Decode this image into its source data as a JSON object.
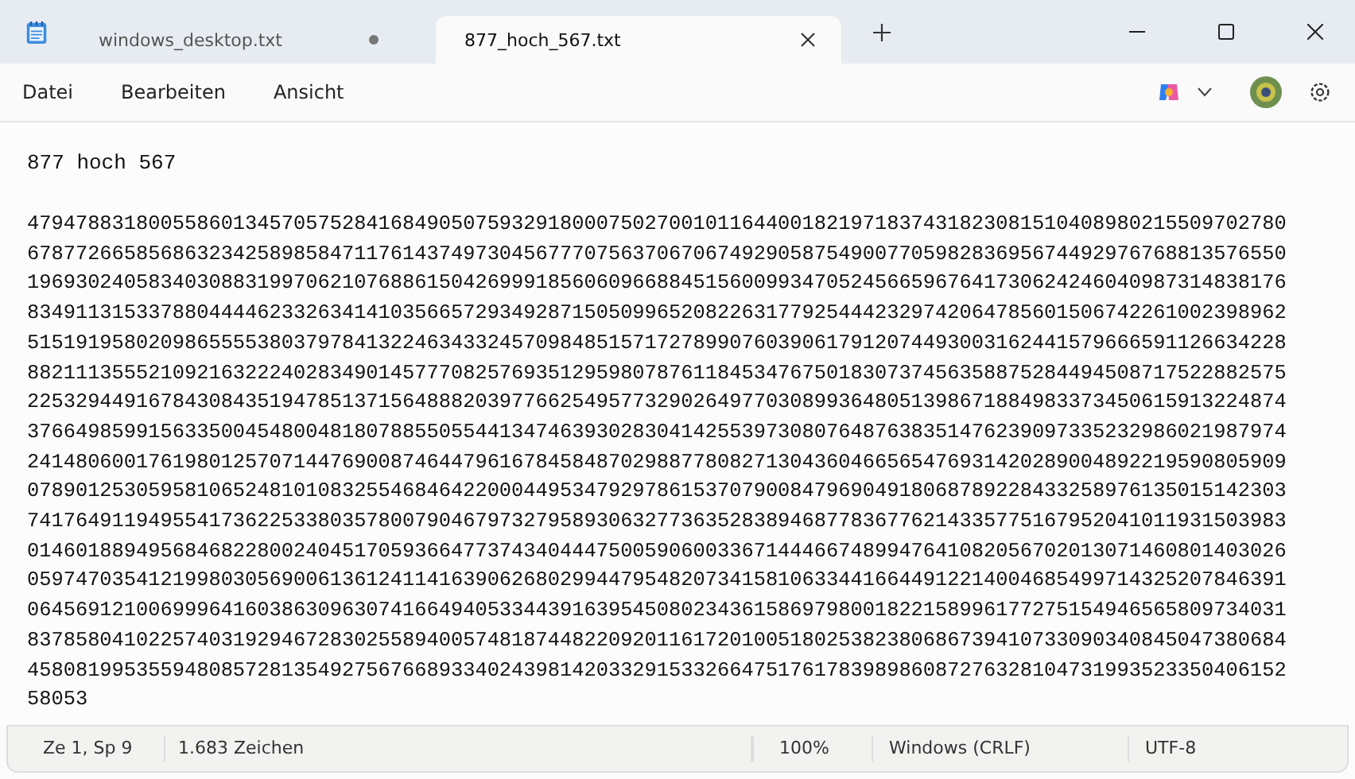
{
  "tabs": [
    {
      "label": "windows_desktop.txt",
      "selected": false,
      "unsaved": true
    },
    {
      "label": "877_hoch_567.txt",
      "selected": true,
      "unsaved": false
    }
  ],
  "menu": [
    "Datei",
    "Bearbeiten",
    "Ansicht"
  ],
  "editor": {
    "first_line": "877 hoch 567",
    "number_lines": [
      "47947883180055860134570575284168490507593291800075027001011644001821971837431823081510408980215509702780",
      "67877266585686323425898584711761437497304567770756370670674929058754900770598283695674492976768813576550",
      "19693024058340308831997062107688615042699918560609668845156009934705245665967641730624246040987314838176",
      "83491131533788044446233263414103566572934928715050996520822631779254442329742064785601506742261002398962",
      "51519195802098655553803797841322463433245709848515717278990760390617912074493003162441579666591126634228",
      "88211135552109216322240283490145777082576935129598078761184534767501830737456358875284494508717522882575",
      "22532944916784308435194785137156488820397766254957732902649770308993648051398671884983373450615913224874",
      "37664985991563350045480048180788550554413474639302830414255397308076487638351476239097335232986021987974",
      "24148060017619801257071447690087464479616784584870298877808271304360466565476931420289004892219590805909",
      "07890125305958106524810108325546846422000449534792978615370790084796904918068789228433258976135015142303",
      "74176491194955417362253380357800790467973279589306327736352838946877836776214335775167952041011931503983",
      "01460188949568468228002404517059366477374340444750059060033671444667489947641082056702013071460801403026",
      "05974703541219980305690061361241141639062680299447954820734158106334416644912214004685499714325207846391",
      "06456912100699964160386309630741664940533443916395450802343615869798001822158996177275154946565809734031",
      "83785804102257403192946728302558940057481874482209201161720100518025382380686739410733090340845047380684",
      "45808199535594808572813549275676689334024398142033291533266475176178398986087276328104731993523350406152",
      "58053"
    ]
  },
  "status_bar": {
    "position": "Ze 1, Sp 9",
    "characters": "1.683 Zeichen",
    "zoom": "100%",
    "line_endings": "Windows (CRLF)",
    "encoding": "UTF-8"
  }
}
